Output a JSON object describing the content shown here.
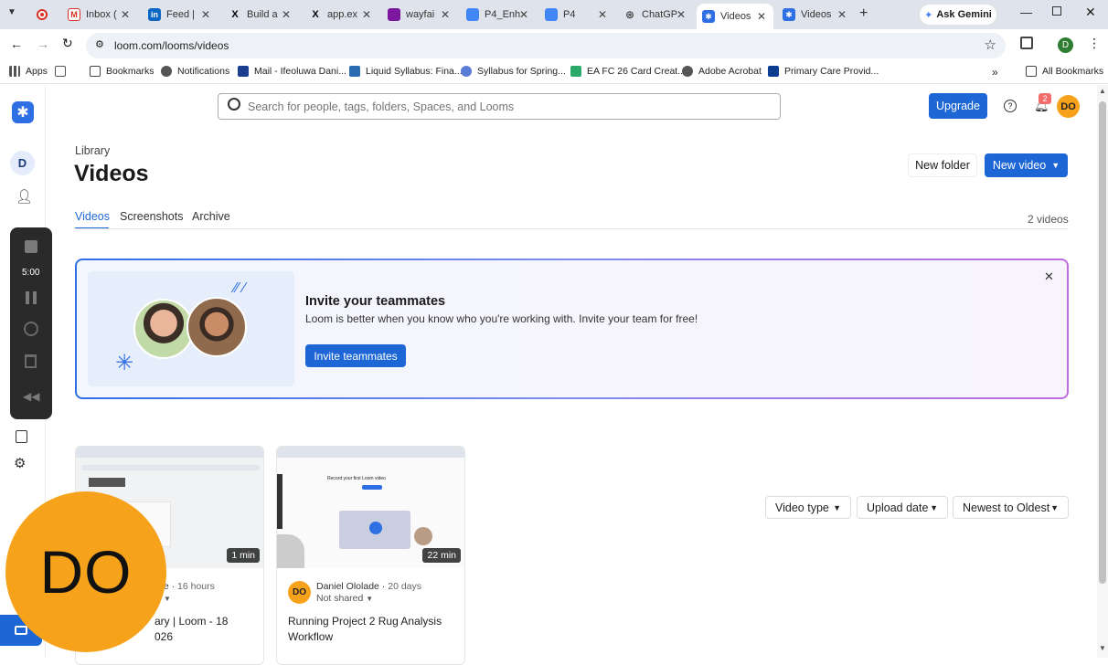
{
  "tabs": [
    {
      "label": "Inbox (",
      "icon": "gmail-icon",
      "color": "#d93025"
    },
    {
      "label": "Feed |",
      "icon": "linkedin-icon",
      "color": "#0a66c2"
    },
    {
      "label": "Build a",
      "icon": "x-icon",
      "color": "#000000"
    },
    {
      "label": "app.ex",
      "icon": "x-icon",
      "color": "#000000"
    },
    {
      "label": "wayfai",
      "icon": "wayfair-icon",
      "color": "#7b189f"
    },
    {
      "label": "P4_Enh",
      "icon": "docs-icon",
      "color": "#4285f4"
    },
    {
      "label": "P4",
      "icon": "slides-icon",
      "color": "#4285f4"
    },
    {
      "label": "ChatGP",
      "icon": "chatgpt-icon",
      "color": "#444444"
    },
    {
      "label": "Videos",
      "icon": "loom-icon",
      "color": "#2f6fe4"
    },
    {
      "label": "Videos",
      "icon": "loom-icon",
      "color": "#2f6fe4"
    }
  ],
  "browser": {
    "url": "loom.com/looms/videos",
    "ask_gemini": "Ask Gemini",
    "profile_initial": "D"
  },
  "bookmarks": [
    "Apps",
    "Bookmarks",
    "Notifications",
    "Mail - Ifeoluwa Dani...",
    "Liquid Syllabus: Fina...",
    "Syllabus for Spring...",
    "EA FC 26 Card Creat...",
    "Adobe Acrobat",
    "Primary Care Provid..."
  ],
  "all_bookmarks": "All Bookmarks",
  "search": {
    "placeholder": "Search for people, tags, folders, Spaces, and Looms"
  },
  "header": {
    "upgrade": "Upgrade",
    "notif_count": "2",
    "avatar": "DO"
  },
  "rail": {
    "workspace_initial": "D",
    "timer": "5:00"
  },
  "page": {
    "breadcrumb": "Library",
    "title": "Videos",
    "new_folder": "New folder",
    "new_video": "New video",
    "tabs": [
      "Videos",
      "Screenshots",
      "Archive"
    ],
    "count": "2 videos"
  },
  "invite": {
    "title": "Invite your teammates",
    "body": "Loom is better when you know who you're working with. Invite your team for free!",
    "button": "Invite teammates"
  },
  "filters": [
    "Video type",
    "Upload date",
    "Newest to Oldest"
  ],
  "videos": [
    {
      "duration": "1 min",
      "author": "de",
      "time": "16 hours",
      "title_line1": "ary | Loom - 18",
      "title_line2": "026"
    },
    {
      "duration": "22 min",
      "author": "Daniel Ololade",
      "time": "20 days",
      "sharing": "Not shared",
      "title": "Running Project 2 Rug Analysis Workflow",
      "avatar": "DO",
      "thumb_title": "Record your first Loom video"
    }
  ],
  "webcam_bubble": "DO",
  "colors": {
    "brand": "#1d66d6",
    "avatar_orange": "#f7a21b",
    "loom_blue": "#2f6fe4"
  }
}
